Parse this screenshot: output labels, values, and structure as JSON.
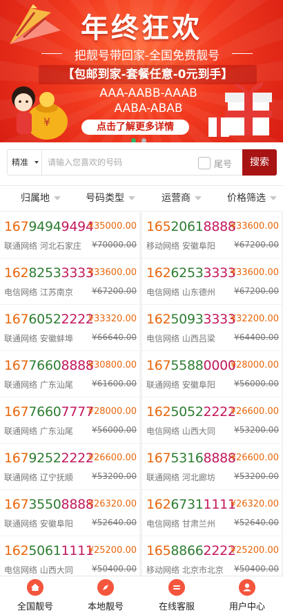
{
  "banner": {
    "title": "年终狂欢",
    "subtitle": "把靓号带回家-全国免费靓号",
    "offer": "【包邮到家-套餐任意-0元到手】",
    "patterns_line1": "AAA-AABB-AAAB",
    "patterns_line2": "AABA-ABAB",
    "cta": "点击了解更多详情",
    "dots": 2,
    "active_dot": 0,
    "colors": {
      "bg": "#f23a1f",
      "cta_text": "#d01f10",
      "dot_active": "#2fb56a",
      "dot_inactive": "#bbbbbb"
    }
  },
  "search": {
    "mode": "精准",
    "placeholder": "请输入您喜欢的号码",
    "tail_label": "尾号",
    "button": "搜索",
    "button_color": "#a81414"
  },
  "filters": [
    "归属地",
    "号码类型",
    "运营商",
    "价格筛选"
  ],
  "listings": [
    {
      "number": [
        "1679",
        "4949494"
      ],
      "price": "¥35000.00",
      "info": "联通网络 河北石家庄",
      "original": "¥70000.00"
    },
    {
      "number": [
        "1652",
        "0618888"
      ],
      "price": "¥33600.00",
      "info": "移动网络 安徽阜阳",
      "original": "¥67200.00"
    },
    {
      "number": [
        "1628",
        "2533333"
      ],
      "price": "¥33600.00",
      "info": "电信网络 江苏南京",
      "original": "¥67200.00"
    },
    {
      "number": [
        "1626",
        "2533333"
      ],
      "price": "¥33600.00",
      "info": "电信网络 山东德州",
      "original": "¥67200.00"
    },
    {
      "number": [
        "1676",
        "0522222"
      ],
      "price": "¥33320.00",
      "info": "联通网络 安徽蚌埠",
      "original": "¥66640.00"
    },
    {
      "number": [
        "1625",
        "0933333"
      ],
      "price": "¥32200.00",
      "info": "电信网络 山西吕梁",
      "original": "¥64400.00"
    },
    {
      "number": [
        "1677",
        "6608888"
      ],
      "price": "¥30800.00",
      "info": "联通网络 广东汕尾",
      "original": "¥61600.00"
    },
    {
      "number": [
        "1675",
        "5880000"
      ],
      "price": "¥28000.00",
      "info": "联通网络 安徽阜阳",
      "original": "¥56000.00"
    },
    {
      "number": [
        "1677",
        "6607777"
      ],
      "price": "¥28000.00",
      "info": "联通网络 广东汕尾",
      "original": "¥56000.00"
    },
    {
      "number": [
        "1625",
        "0522222"
      ],
      "price": "¥26600.00",
      "info": "电信网络 山西大同",
      "original": "¥53200.00"
    },
    {
      "number": [
        "1679",
        "2522222"
      ],
      "price": "¥26600.00",
      "info": "联通网络 辽宁抚顺",
      "original": "¥53200.00"
    },
    {
      "number": [
        "1675",
        "3168888"
      ],
      "price": "¥26600.00",
      "info": "联通网络 河北廊坊",
      "original": "¥53200.00"
    },
    {
      "number": [
        "1673",
        "5508888"
      ],
      "price": "¥26320.00",
      "info": "联通网络 安徽阜阳",
      "original": "¥52640.00"
    },
    {
      "number": [
        "1626",
        "7311111"
      ],
      "price": "¥26320.00",
      "info": "电信网络 甘肃兰州",
      "original": "¥52640.00"
    },
    {
      "number": [
        "1625",
        "0611111"
      ],
      "price": "¥25200.00",
      "info": "电信网络 山西大同",
      "original": "¥50400.00"
    },
    {
      "number": [
        "1658",
        "8662222"
      ],
      "price": "¥25200.00",
      "info": "移动网络 北京市北京",
      "original": "¥50400.00"
    }
  ],
  "number_colors": {
    "prefix": "#e8650a",
    "middle": "#2e7d32",
    "tail": "#c2185b"
  },
  "nav": [
    {
      "label": "全国靓号",
      "icon": "home-icon"
    },
    {
      "label": "本地靓号",
      "icon": "compass-icon"
    },
    {
      "label": "在线客服",
      "icon": "chat-icon"
    },
    {
      "label": "用户中心",
      "icon": "user-icon"
    }
  ],
  "nav_icon_color": "#f4553d"
}
